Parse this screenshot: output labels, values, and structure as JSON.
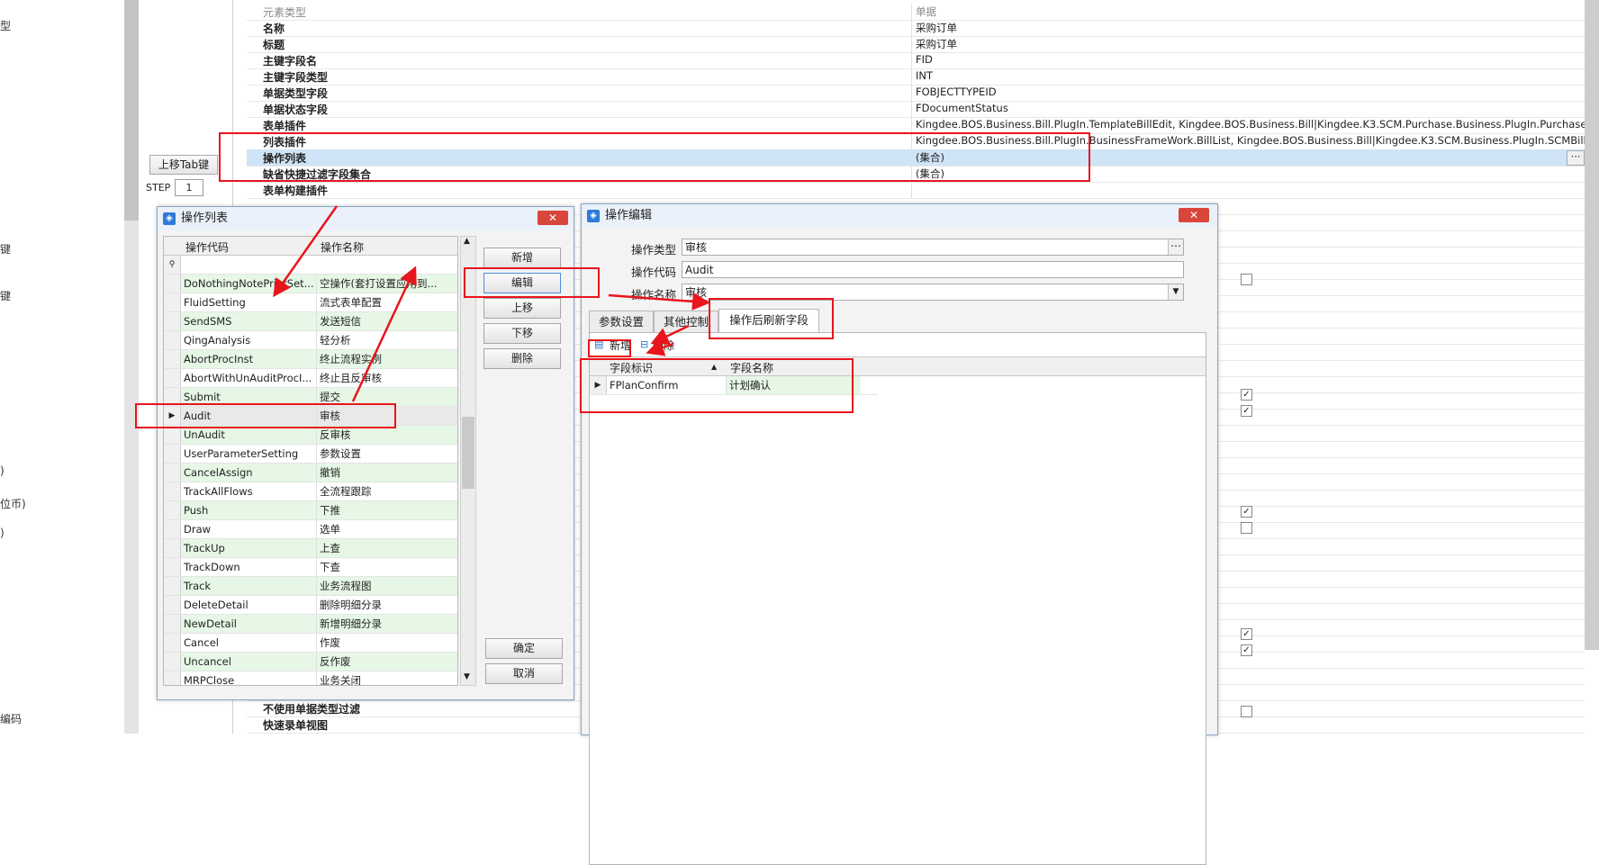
{
  "left_edge_labels": [
    "型",
    "键",
    "键",
    ")",
    "位币)",
    ")",
    "编码"
  ],
  "tab_key_button": "上移Tab键",
  "step": {
    "label": "STEP",
    "value": "1"
  },
  "properties": [
    {
      "name": "元素类型",
      "value": "单据",
      "muted": true
    },
    {
      "name": "名称",
      "value": "采购订单"
    },
    {
      "name": "标题",
      "value": "采购订单"
    },
    {
      "name": "主键字段名",
      "value": "FID"
    },
    {
      "name": "主键字段类型",
      "value": "INT"
    },
    {
      "name": "单据类型字段",
      "value": "FOBJECTTYPEID"
    },
    {
      "name": "单据状态字段",
      "value": "FDocumentStatus"
    },
    {
      "name": "表单插件",
      "value": "Kingdee.BOS.Business.Bill.PlugIn.TemplateBillEdit, Kingdee.BOS.Business.Bill|Kingdee.K3.SCM.Purchase.Business.PlugIn.PurchaseBillEdi..."
    },
    {
      "name": "列表插件",
      "value": "Kingdee.BOS.Business.Bill.PlugIn.BusinessFrameWork.BillList, Kingdee.BOS.Business.Bill|Kingdee.K3.SCM.Business.PlugIn.SCMBillList, Ki..."
    },
    {
      "name": "操作列表",
      "value": "(集合)",
      "selected": true
    },
    {
      "name": "缺省快捷过滤字段集合",
      "value": "(集合)"
    },
    {
      "name": "表单构建插件",
      "value": ""
    }
  ],
  "bottom_properties": [
    {
      "name": "不使用单据类型过滤"
    },
    {
      "name": "快速录单视图"
    }
  ],
  "grid_right_fragment": "es",
  "checkboxes": [
    {
      "checked": false
    },
    {
      "checked": true
    },
    {
      "checked": true
    },
    {
      "checked": true
    },
    {
      "checked": false
    },
    {
      "checked": true
    },
    {
      "checked": true
    },
    {
      "checked": false
    }
  ],
  "op_list_dialog": {
    "title": "操作列表",
    "close": "✕",
    "columns": [
      "操作代码",
      "操作名称"
    ],
    "filter_icon": "⚲",
    "rows": [
      {
        "code": "DoNothingNotePrintSet...",
        "name": "空操作(套打设置应用到...",
        "green": true
      },
      {
        "code": "FluidSetting",
        "name": "流式表单配置",
        "green": false
      },
      {
        "code": "SendSMS",
        "name": "发送短信",
        "green": true
      },
      {
        "code": "QingAnalysis",
        "name": "轻分析",
        "green": false
      },
      {
        "code": "AbortProcInst",
        "name": "终止流程实例",
        "green": true
      },
      {
        "code": "AbortWithUnAuditProcI...",
        "name": "终止且反审核",
        "green": false
      },
      {
        "code": "Submit",
        "name": "提交",
        "green": true
      },
      {
        "code": "Audit",
        "name": "审核",
        "green": false,
        "current": true
      },
      {
        "code": "UnAudit",
        "name": "反审核",
        "green": true
      },
      {
        "code": "UserParameterSetting",
        "name": "参数设置",
        "green": false
      },
      {
        "code": "CancelAssign",
        "name": "撤销",
        "green": true
      },
      {
        "code": "TrackAllFlows",
        "name": "全流程跟踪",
        "green": false
      },
      {
        "code": "Push",
        "name": "下推",
        "green": true
      },
      {
        "code": "Draw",
        "name": "选单",
        "green": false
      },
      {
        "code": "TrackUp",
        "name": "上查",
        "green": true
      },
      {
        "code": "TrackDown",
        "name": "下查",
        "green": false
      },
      {
        "code": "Track",
        "name": "业务流程图",
        "green": true
      },
      {
        "code": "DeleteDetail",
        "name": "删除明细分录",
        "green": false
      },
      {
        "code": "NewDetail",
        "name": "新增明细分录",
        "green": true
      },
      {
        "code": "Cancel",
        "name": "作废",
        "green": false
      },
      {
        "code": "Uncancel",
        "name": "反作废",
        "green": true
      },
      {
        "code": "MRPClose",
        "name": "业务关闭",
        "green": false
      }
    ],
    "buttons": {
      "add": "新增",
      "edit": "编辑",
      "up": "上移",
      "down": "下移",
      "delete": "删除",
      "ok": "确定",
      "cancel": "取消"
    }
  },
  "op_edit_dialog": {
    "title": "操作编辑",
    "close": "✕",
    "fields": {
      "type_label": "操作类型",
      "type_value": "审核",
      "code_label": "操作代码",
      "code_value": "Audit",
      "name_label": "操作名称",
      "name_value": "审核"
    },
    "tabs": [
      "参数设置",
      "其他控制",
      "操作后刷新字段"
    ],
    "toolbar": {
      "add": "新增",
      "delete": "删除"
    },
    "grid_columns": [
      "字段标识",
      "字段名称"
    ],
    "grid_rows": [
      {
        "id": "FPlanConfirm",
        "name": "计划确认"
      }
    ]
  },
  "colors": {
    "highlight_red": "#e8151c",
    "selected_row": "#cfe4f7",
    "green_row": "#e6f7e6",
    "title_icon": "#2f7bd8",
    "close_button": "#d9463b"
  }
}
